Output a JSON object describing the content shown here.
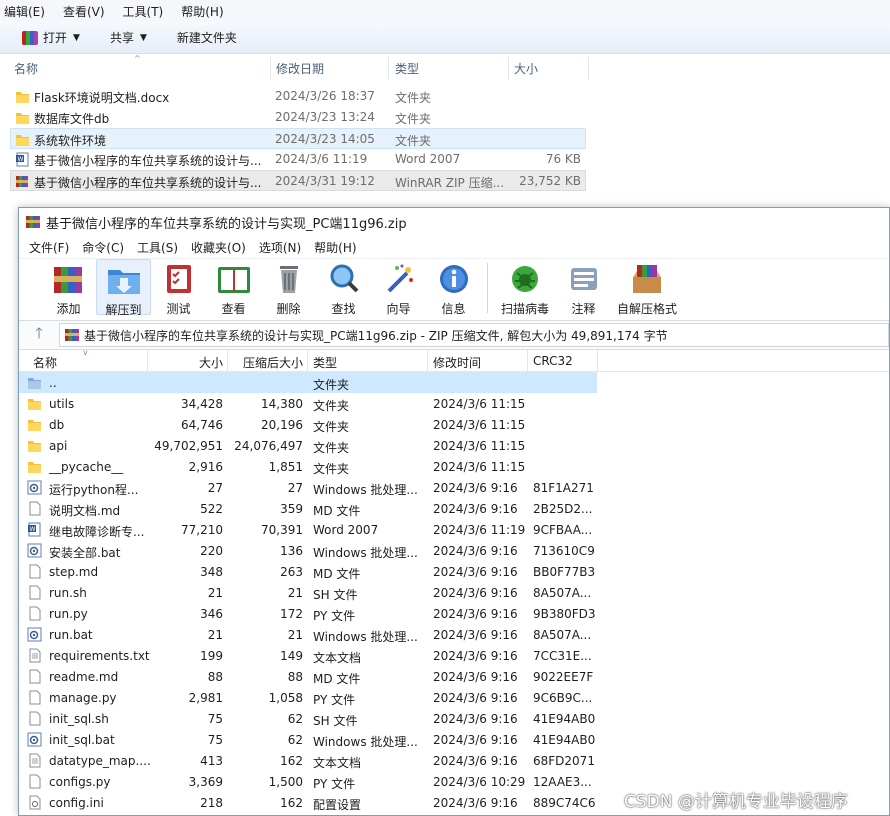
{
  "explorer": {
    "menu": [
      "编辑(E)",
      "查看(V)",
      "工具(T)",
      "帮助(H)"
    ],
    "toolbar": {
      "open": "打开",
      "share": "共享",
      "new_folder": "新建文件夹"
    },
    "columns": {
      "name": "名称",
      "date": "修改日期",
      "type": "类型",
      "size": "大小"
    },
    "rows": [
      {
        "name": "Flask环境说明文档.docx",
        "date": "2024/3/26 18:37",
        "type": "文件夹",
        "size": "",
        "icon": "folder-icon"
      },
      {
        "name": "数据库文件db",
        "date": "2024/3/23 13:24",
        "type": "文件夹",
        "size": "",
        "icon": "folder-icon"
      },
      {
        "name": "系统软件环境",
        "date": "2024/3/23 14:05",
        "type": "文件夹",
        "size": "",
        "icon": "folder-icon"
      },
      {
        "name": "基于微信小程序的车位共享系统的设计与...",
        "date": "2024/3/6 11:19",
        "type": "Word 2007",
        "size": "76 KB",
        "icon": "word-document-icon"
      },
      {
        "name": "基于微信小程序的车位共享系统的设计与...",
        "date": "2024/3/31 19:12",
        "type": "WinRAR ZIP 压缩...",
        "size": "23,752 KB",
        "icon": "winrar-archive-icon"
      }
    ]
  },
  "winrar": {
    "title": "基于微信小程序的车位共享系统的设计与实现_PC端11g96.zip",
    "menu": [
      "文件(F)",
      "命令(C)",
      "工具(S)",
      "收藏夹(O)",
      "选项(N)",
      "帮助(H)"
    ],
    "tools": [
      {
        "label": "添加",
        "icon": "add-archive-icon"
      },
      {
        "label": "解压到",
        "icon": "extract-to-icon"
      },
      {
        "label": "测试",
        "icon": "test-icon"
      },
      {
        "label": "查看",
        "icon": "view-icon"
      },
      {
        "label": "删除",
        "icon": "delete-icon"
      },
      {
        "label": "查找",
        "icon": "find-icon"
      },
      {
        "label": "向导",
        "icon": "wizard-icon"
      },
      {
        "label": "信息",
        "icon": "info-icon"
      },
      {
        "label": "扫描病毒",
        "icon": "virus-scan-icon"
      },
      {
        "label": "注释",
        "icon": "comment-icon"
      },
      {
        "label": "自解压格式",
        "icon": "sfx-icon"
      }
    ],
    "path_text": "基于微信小程序的车位共享系统的设计与实现_PC端11g96.zip - ZIP 压缩文件, 解包大小为 49,891,174 字节",
    "columns": {
      "name": "名称",
      "size": "大小",
      "packed": "压缩后大小",
      "type": "类型",
      "modified": "修改时间",
      "crc": "CRC32"
    },
    "files": [
      {
        "name": "..",
        "size": "",
        "packed": "",
        "type": "文件夹",
        "modified": "",
        "crc": "",
        "icon": "folder-up-icon"
      },
      {
        "name": "utils",
        "size": "34,428",
        "packed": "14,380",
        "type": "文件夹",
        "modified": "2024/3/6 11:15",
        "crc": "",
        "icon": "folder-icon"
      },
      {
        "name": "db",
        "size": "64,746",
        "packed": "20,196",
        "type": "文件夹",
        "modified": "2024/3/6 11:15",
        "crc": "",
        "icon": "folder-icon"
      },
      {
        "name": "api",
        "size": "49,702,951",
        "packed": "24,076,497",
        "type": "文件夹",
        "modified": "2024/3/6 11:15",
        "crc": "",
        "icon": "folder-icon"
      },
      {
        "name": "__pycache__",
        "size": "2,916",
        "packed": "1,851",
        "type": "文件夹",
        "modified": "2024/3/6 11:15",
        "crc": "",
        "icon": "folder-icon"
      },
      {
        "name": "运行python程...",
        "size": "27",
        "packed": "27",
        "type": "Windows 批处理...",
        "modified": "2024/3/6 9:16",
        "crc": "81F1A271",
        "icon": "batch-file-icon"
      },
      {
        "name": "说明文档.md",
        "size": "522",
        "packed": "359",
        "type": "MD 文件",
        "modified": "2024/3/6 9:16",
        "crc": "2B25D2...",
        "icon": "file-icon"
      },
      {
        "name": "继电故障诊断专...",
        "size": "77,210",
        "packed": "70,391",
        "type": "Word 2007",
        "modified": "2024/3/6 11:19",
        "crc": "9CFBAA...",
        "icon": "word-document-icon"
      },
      {
        "name": "安装全部.bat",
        "size": "220",
        "packed": "136",
        "type": "Windows 批处理...",
        "modified": "2024/3/6 9:16",
        "crc": "713610C9",
        "icon": "batch-file-icon"
      },
      {
        "name": "step.md",
        "size": "348",
        "packed": "263",
        "type": "MD 文件",
        "modified": "2024/3/6 9:16",
        "crc": "BB0F77B3",
        "icon": "file-icon"
      },
      {
        "name": "run.sh",
        "size": "21",
        "packed": "21",
        "type": "SH 文件",
        "modified": "2024/3/6 9:16",
        "crc": "8A507A...",
        "icon": "file-icon"
      },
      {
        "name": "run.py",
        "size": "346",
        "packed": "172",
        "type": "PY 文件",
        "modified": "2024/3/6 9:16",
        "crc": "9B380FD3",
        "icon": "file-icon"
      },
      {
        "name": "run.bat",
        "size": "21",
        "packed": "21",
        "type": "Windows 批处理...",
        "modified": "2024/3/6 9:16",
        "crc": "8A507A...",
        "icon": "batch-file-icon"
      },
      {
        "name": "requirements.txt",
        "size": "199",
        "packed": "149",
        "type": "文本文档",
        "modified": "2024/3/6 9:16",
        "crc": "7CC31E...",
        "icon": "text-file-icon"
      },
      {
        "name": "readme.md",
        "size": "88",
        "packed": "88",
        "type": "MD 文件",
        "modified": "2024/3/6 9:16",
        "crc": "9022EE7F",
        "icon": "file-icon"
      },
      {
        "name": "manage.py",
        "size": "2,981",
        "packed": "1,058",
        "type": "PY 文件",
        "modified": "2024/3/6 9:16",
        "crc": "9C6B9C...",
        "icon": "file-icon"
      },
      {
        "name": "init_sql.sh",
        "size": "75",
        "packed": "62",
        "type": "SH 文件",
        "modified": "2024/3/6 9:16",
        "crc": "41E94AB0",
        "icon": "file-icon"
      },
      {
        "name": "init_sql.bat",
        "size": "75",
        "packed": "62",
        "type": "Windows 批处理...",
        "modified": "2024/3/6 9:16",
        "crc": "41E94AB0",
        "icon": "batch-file-icon"
      },
      {
        "name": "datatype_map....",
        "size": "413",
        "packed": "162",
        "type": "文本文档",
        "modified": "2024/3/6 9:16",
        "crc": "68FD2071",
        "icon": "text-file-icon"
      },
      {
        "name": "configs.py",
        "size": "3,369",
        "packed": "1,500",
        "type": "PY 文件",
        "modified": "2024/3/6 10:29",
        "crc": "12AAE3...",
        "icon": "file-icon"
      },
      {
        "name": "config.ini",
        "size": "218",
        "packed": "162",
        "type": "配置设置",
        "modified": "2024/3/6 9:16",
        "crc": "889C74C6",
        "icon": "settings-file-icon"
      }
    ]
  },
  "watermark": "CSDN @计算机专业毕设程序"
}
